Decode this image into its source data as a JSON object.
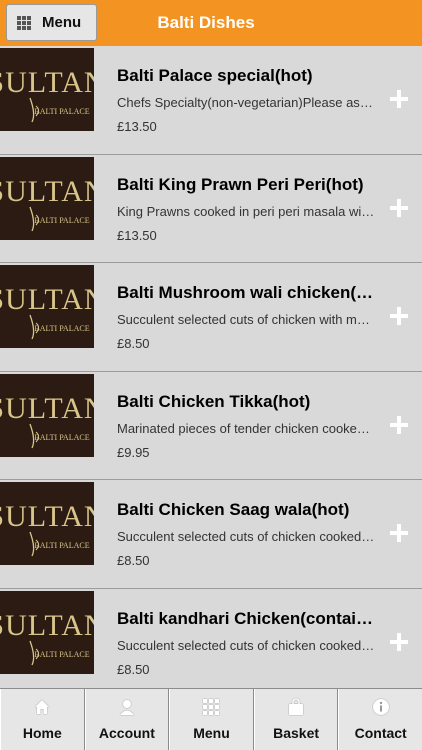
{
  "header": {
    "menu_label": "Menu",
    "title": "Balti Dishes",
    "accent": "#f39321"
  },
  "thumbnail": {
    "logo_text": "SULTAN",
    "logo_sub": "BALTI PALACE"
  },
  "items": [
    {
      "name": "Balti Palace special(hot)",
      "desc": "Chefs Specialty(non-vegetarian)Please ask waiter for details",
      "price": "£13.50"
    },
    {
      "name": "Balti King Prawn Peri Peri(hot)",
      "desc": "King Prawns cooked in peri peri masala with fresh chillies",
      "price": "£13.50"
    },
    {
      "name": "Balti Mushroom wali chicken(medium)",
      "desc": "Succulent selected cuts of chicken with mushrooms",
      "price": "£8.50"
    },
    {
      "name": "Balti Chicken Tikka(hot)",
      "desc": "Marinated pieces of tender chicken cooked in balti sauce",
      "price": "£9.95"
    },
    {
      "name": "Balti Chicken Saag wala(hot)",
      "desc": "Succulent selected cuts of chicken cooked with spinach",
      "price": "£8.50"
    },
    {
      "name": "Balti kandhari Chicken(contains nuts)",
      "desc": "Succulent selected cuts of chicken cooked with nuts",
      "price": "£8.50"
    }
  ],
  "tabs": [
    {
      "label": "Home",
      "icon": "home-icon"
    },
    {
      "label": "Account",
      "icon": "user-icon"
    },
    {
      "label": "Menu",
      "icon": "grid-icon"
    },
    {
      "label": "Basket",
      "icon": "basket-icon"
    },
    {
      "label": "Contact",
      "icon": "info-icon"
    }
  ]
}
